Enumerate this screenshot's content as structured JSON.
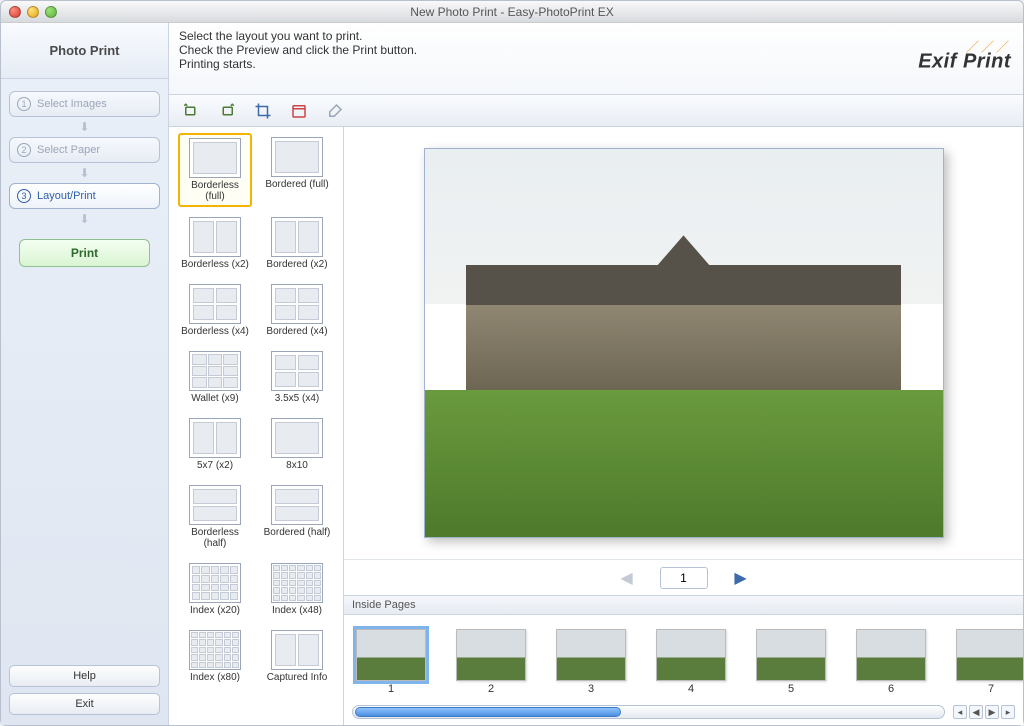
{
  "window": {
    "title": "New Photo Print - Easy-PhotoPrint EX"
  },
  "sidebar": {
    "title": "Photo Print",
    "steps": [
      {
        "num": "①",
        "label": "Select Images"
      },
      {
        "num": "②",
        "label": "Select Paper"
      },
      {
        "num": "③",
        "label": "Layout/Print"
      }
    ],
    "print_label": "Print",
    "help_label": "Help",
    "exit_label": "Exit"
  },
  "instructions": {
    "line1": "Select the layout you want to print.",
    "line2": "Check the Preview and click the Print button.",
    "line3": "Printing starts."
  },
  "brand": {
    "text": "Exif Print"
  },
  "toolbar_icons": [
    "rotate-left-icon",
    "rotate-right-icon",
    "crop-icon",
    "date-icon",
    "brush-icon"
  ],
  "layouts": [
    {
      "id": "borderless-full",
      "label": "Borderless (full)",
      "kind": "thumb-one",
      "selected": true
    },
    {
      "id": "bordered-full",
      "label": "Bordered (full)",
      "kind": "thumb-one"
    },
    {
      "id": "borderless-x2",
      "label": "Borderless (x2)",
      "kind": "thumb-half"
    },
    {
      "id": "bordered-x2",
      "label": "Bordered (x2)",
      "kind": "thumb-half"
    },
    {
      "id": "borderless-x4",
      "label": "Borderless (x4)",
      "kind": "thumb-fourths"
    },
    {
      "id": "bordered-x4",
      "label": "Bordered (x4)",
      "kind": "thumb-fourths"
    },
    {
      "id": "wallet-x9",
      "label": "Wallet (x9)",
      "kind": "thumb-nine"
    },
    {
      "id": "35x5-x4",
      "label": "3.5x5 (x4)",
      "kind": "thumb-fourths"
    },
    {
      "id": "5x7-x2",
      "label": "5x7 (x2)",
      "kind": "thumb-half"
    },
    {
      "id": "8x10",
      "label": "8x10",
      "kind": "thumb-one"
    },
    {
      "id": "borderless-half",
      "label": "Borderless (half)",
      "kind": "thumb-vert-half"
    },
    {
      "id": "bordered-half",
      "label": "Bordered (half)",
      "kind": "thumb-vert-half"
    },
    {
      "id": "index-x20",
      "label": "Index (x20)",
      "kind": "thumb-index"
    },
    {
      "id": "index-x48",
      "label": "Index (x48)",
      "kind": "thumb-index48"
    },
    {
      "id": "index-x80",
      "label": "Index (x80)",
      "kind": "thumb-index48"
    },
    {
      "id": "captured-info",
      "label": "Captured Info",
      "kind": "thumb-half"
    }
  ],
  "pager": {
    "current": "1"
  },
  "strip": {
    "header": "Inside Pages",
    "thumbs": [
      {
        "n": "1",
        "selected": true
      },
      {
        "n": "2"
      },
      {
        "n": "3"
      },
      {
        "n": "4"
      },
      {
        "n": "5"
      },
      {
        "n": "6"
      },
      {
        "n": "7"
      }
    ]
  }
}
